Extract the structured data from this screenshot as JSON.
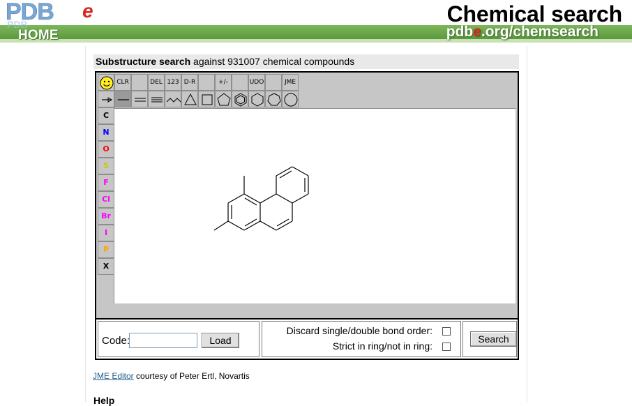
{
  "header": {
    "logo_text": "PDBe",
    "home_label": "HOME",
    "title": "Chemical search",
    "url_prefix": "pdb",
    "url_accent": "e",
    "url_suffix": ".org/chemsearch"
  },
  "search": {
    "heading_bold": "Substructure search",
    "heading_rest": " against 931007 chemical compounds"
  },
  "jme": {
    "top_labels": [
      "",
      "CLR",
      "",
      "DEL",
      "123",
      "D-R",
      "",
      "+/-",
      "",
      "UDO",
      "",
      "JME"
    ],
    "tools": [
      {
        "name": "select-tool",
        "icon": "arrow-icon"
      },
      {
        "name": "single-bond-tool",
        "icon": "single-bond-icon",
        "selected": true
      },
      {
        "name": "double-bond-tool",
        "icon": "double-bond-icon"
      },
      {
        "name": "triple-bond-tool",
        "icon": "triple-bond-icon"
      },
      {
        "name": "chain-tool",
        "icon": "chain-icon"
      },
      {
        "name": "ring3-tool",
        "icon": "triangle-icon"
      },
      {
        "name": "ring4-tool",
        "icon": "square-icon"
      },
      {
        "name": "ring5-tool",
        "icon": "pentagon-icon"
      },
      {
        "name": "benzene-tool",
        "icon": "benzene-icon"
      },
      {
        "name": "ring6-tool",
        "icon": "hexagon-icon"
      },
      {
        "name": "ring7-tool",
        "icon": "heptagon-icon"
      },
      {
        "name": "ring8-tool",
        "icon": "octagon-icon"
      }
    ],
    "atoms": [
      {
        "label": "C",
        "color": "#000000"
      },
      {
        "label": "N",
        "color": "#0000ff"
      },
      {
        "label": "O",
        "color": "#ff0000"
      },
      {
        "label": "S",
        "color": "#c8c800"
      },
      {
        "label": "F",
        "color": "#ff00ff"
      },
      {
        "label": "Cl",
        "color": "#ff00ff"
      },
      {
        "label": "Br",
        "color": "#ff00ff"
      },
      {
        "label": "I",
        "color": "#ff00ff"
      },
      {
        "label": "P",
        "color": "#ffa500"
      },
      {
        "label": "X",
        "color": "#000000"
      }
    ]
  },
  "controls": {
    "code_label": "Code:",
    "code_value": "",
    "load_label": "Load",
    "discard_label": "Discard single/double bond order:",
    "strict_label": "Strict in ring/not in ring:",
    "search_label": "Search"
  },
  "credit": {
    "link_text": "JME Editor",
    "rest": " courtesy of Peter Ertl, Novartis"
  },
  "help": {
    "heading": "Help"
  },
  "colors": {
    "header_green": "#6aa84f",
    "panel_gray": "#c6c6c6",
    "link_blue": "#1f5d8a",
    "accent_red": "#e2231a"
  }
}
